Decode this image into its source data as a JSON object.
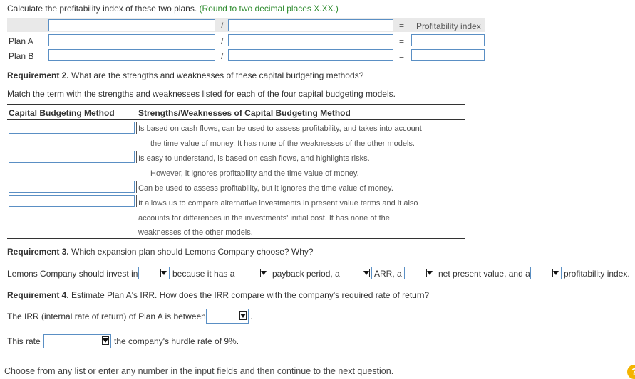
{
  "q1": {
    "prompt": "Calculate the profitability index of these two plans.",
    "hint": "(Round to two decimal places X.XX.)",
    "divide_symbol": "/",
    "equals_symbol": "=",
    "result_header": "Profitability index",
    "rows": [
      {
        "label": "Plan A"
      },
      {
        "label": "Plan B"
      }
    ]
  },
  "req2": {
    "heading": "Requirement 2.",
    "question": " What are the strengths and weaknesses of these capital budgeting methods?",
    "instruction": "Match the term with the strengths and weaknesses listed for each of the four capital budgeting models.",
    "col1_header": "Capital Budgeting Method",
    "col2_header": "Strengths/Weaknesses of Capital Budgeting Method",
    "items": [
      {
        "lines": [
          "Is based on cash flows, can be used to assess profitability, and takes into account",
          "the time value of money. It has none of the weaknesses of the other models."
        ]
      },
      {
        "lines": [
          "Is easy to understand, is based on cash flows, and highlights risks.",
          "However, it ignores profitability and the time value of money."
        ]
      },
      {
        "lines": [
          "Can be used to assess profitability, but it ignores the time value of money."
        ]
      },
      {
        "lines": [
          "It allows us to compare alternative investments in present value terms and it also",
          "accounts for differences in the investments' initial cost. It has none of the",
          "weaknesses of the other models."
        ]
      }
    ]
  },
  "req3": {
    "heading": "Requirement 3.",
    "question": " Which expansion plan should Lemons Company choose? Why?",
    "sentence": {
      "p1": "Lemons Company should invest in",
      "p2": "because it has a",
      "p3": "payback period, a",
      "p4": "ARR, a",
      "p5": "net present value, and a",
      "p6": "profitability index."
    }
  },
  "req4": {
    "heading": "Requirement 4.",
    "question": " Estimate Plan A's IRR. How does the IRR compare with the company's required rate of return?",
    "irr_text": "The IRR (internal rate of return) of Plan A is between",
    "irr_end": ".",
    "rate_p1": "This rate",
    "rate_p2": "the company's hurdle rate of 9%."
  },
  "footer": {
    "instruction": "Choose from any list or enter any number in the input fields and then continue to the next question.",
    "help_label": "?"
  }
}
